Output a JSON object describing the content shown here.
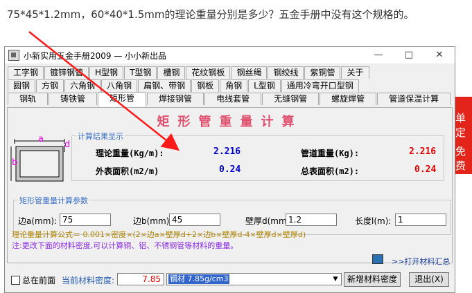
{
  "question": "75*45*1.2mm，60*40*1.5mm的理论重量分别是多少？五金手册中没有这个规格的。",
  "window": {
    "title": "小新实用五金手册2009 — 小小新出品",
    "minimize": "—",
    "maximize": "□",
    "close": "✕"
  },
  "tabs": {
    "row1": [
      "工字钢",
      "镀锌钢管",
      "H型钢",
      "T型钢",
      "槽钢",
      "花纹钢板",
      "钢丝绳",
      "钢绞线",
      "紫铜管",
      "关于"
    ],
    "row2": [
      "圆钢",
      "方钢",
      "六角钢",
      "八角钢",
      "扁钢、带钢",
      "钢板",
      "角钢",
      "L型钢",
      "通用冷弯开口型钢"
    ],
    "row3": [
      "钢轨",
      "铸铁管",
      "矩形管",
      "焊接钢管",
      "电线套管",
      "无缝钢管",
      "螺旋焊管",
      "管道保温计算"
    ],
    "active": "矩形管"
  },
  "panel": {
    "heading": "矩形管重量计算",
    "results_group": "计算结果显示",
    "theory_weight_label": "理论重量(Kg/m):",
    "theory_weight_value": "2.216",
    "pipe_weight_label": "管道重量(Kg):",
    "pipe_weight_value": "2.216",
    "outer_area_label": "外表面积(m2/m)",
    "outer_area_value": "0.24",
    "total_area_label": "总表面积(m2):",
    "total_area_value": "0.24",
    "diagram_a": "a",
    "diagram_b": "b",
    "diagram_d": "d",
    "params_group": "矩形管重量计算参数",
    "side_a_label": "边a(mm):",
    "side_a_value": "75",
    "side_b_label": "边b(mm):",
    "side_b_value": "45",
    "thickness_label": "壁厚d(mm)",
    "thickness_value": "1.2",
    "length_label": "长度l(m):",
    "length_value": "1",
    "formula": "理论重量计算公式＝ 0.001×密度×(2×边a×壁厚d+2×边b×壁厚d-4×壁厚d×壁厚d)",
    "note": "注:更改下面的材料密度,可以计算铜、铝、不锈钢管等材料的重量。",
    "open_link": ">>打开材料汇总"
  },
  "bottom": {
    "always_on_top": "总在前面",
    "density_label": "当前材料密度:",
    "density_value": "7.85",
    "material_selected": "钢材 7.85g/cm3",
    "add_density_button": "新增材料密度",
    "exit_button": "退出(X)"
  },
  "side_ad": {
    "line1": "单定",
    "line2": "免费"
  },
  "colors": {
    "blue_value": "#0000cc",
    "red_value": "#e00000",
    "heading": "#e0506f",
    "arrow": "#ff1a1a"
  }
}
